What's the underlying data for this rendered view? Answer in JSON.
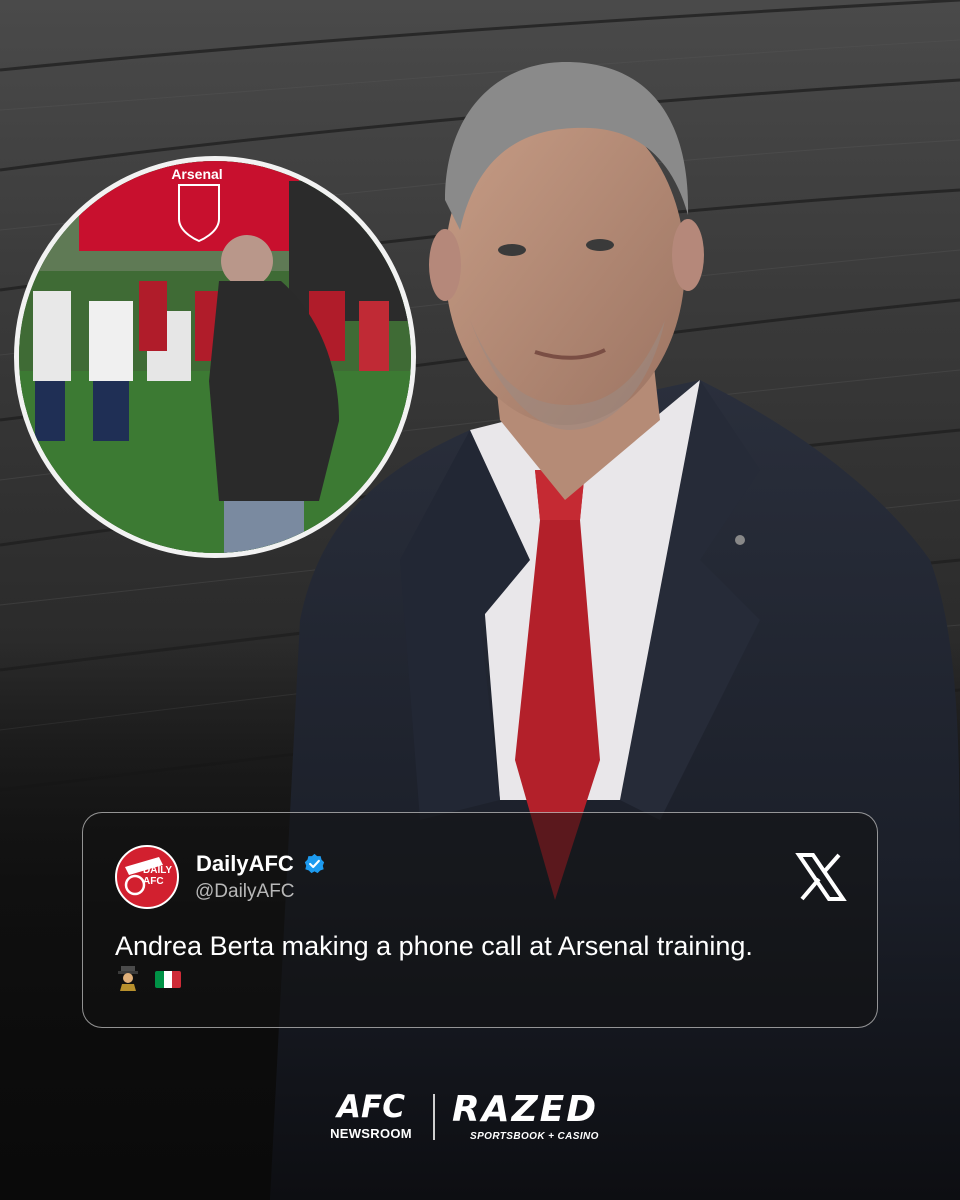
{
  "background": {
    "color_top": "#4a4a4a",
    "color_bottom": "#0d0d0d"
  },
  "inset_photo": {
    "sign_text": "Arsenal",
    "sign_color": "#c8102e"
  },
  "tweet": {
    "display_name": "DailyAFC",
    "handle": "@DailyAFC",
    "verified": true,
    "text": "Andrea Berta making a phone call at Arsenal training.",
    "emojis": [
      "detective-emoji",
      "italy-flag-emoji"
    ],
    "avatar_text": "DAILY AFC",
    "brand_icon": "x-logo-icon"
  },
  "footer": {
    "brand1_main": "AFC",
    "brand1_sub": "NEWSROOM",
    "brand2_main": "RAZED",
    "brand2_sub": "SPORTSBOOK + CASINO"
  },
  "colors": {
    "accent": "#d2202f",
    "verified": "#1d9bf0",
    "tie": "#b3202a",
    "suit": "#1f2430"
  }
}
